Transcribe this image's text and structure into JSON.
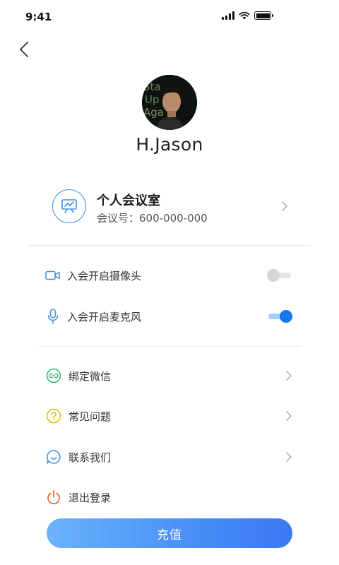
{
  "status_bar": {
    "time": "9:41"
  },
  "profile": {
    "name": "H.Jason",
    "avatar_text": [
      "Sta",
      "Up",
      "Aga"
    ]
  },
  "meeting_room": {
    "title": "个人会议室",
    "number": "会议号：600-000-000"
  },
  "settings": {
    "camera": {
      "label": "入会开启摄像头",
      "enabled": false
    },
    "microphone": {
      "label": "入会开启麦克风",
      "enabled": true
    }
  },
  "menu": {
    "wechat": "绑定微信",
    "faq": "常见问题",
    "contact": "联系我们",
    "logout": "退出登录"
  },
  "recharge_label": "充值",
  "colors": {
    "accent": "#1677f0",
    "icon_blue": "#3d8fe0",
    "wechat_green": "#2fb36f",
    "faq_yellow": "#e6b800",
    "logout_orange": "#e8672a"
  }
}
